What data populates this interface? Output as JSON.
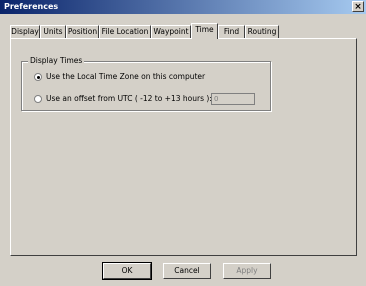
{
  "window": {
    "title": "Preferences",
    "close_glyph": "×"
  },
  "tabs": [
    {
      "label": "Display"
    },
    {
      "label": "Units"
    },
    {
      "label": "Position"
    },
    {
      "label": "File Location"
    },
    {
      "label": "Waypoint"
    },
    {
      "label": "Time"
    },
    {
      "label": "Find"
    },
    {
      "label": "Routing"
    }
  ],
  "active_tab": "Time",
  "display_times": {
    "group_label": "Display Times",
    "options": [
      {
        "label": "Use the Local Time Zone on this computer",
        "selected": true
      },
      {
        "label": "Use an offset from UTC ( -12 to +13  hours ):",
        "selected": false
      }
    ],
    "offset_value": "0"
  },
  "buttons": {
    "ok": "OK",
    "cancel": "Cancel",
    "apply": "Apply"
  }
}
